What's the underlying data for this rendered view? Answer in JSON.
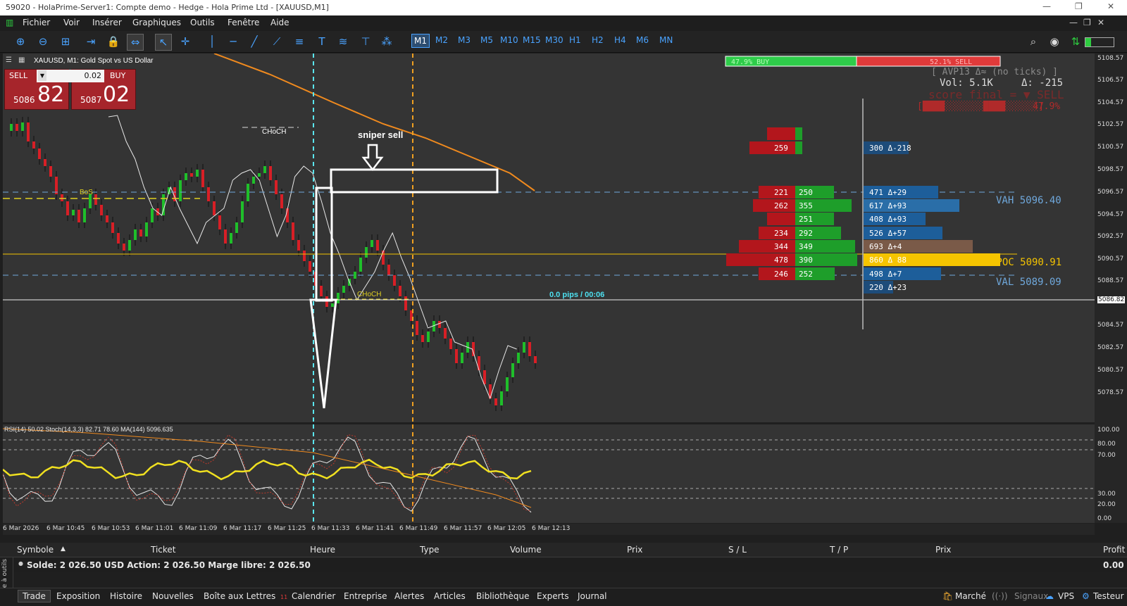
{
  "window": {
    "title": "59020 - HolaPrime-Server1: Compte demo - Hedge - Hola Prime Ltd - [XAUUSD,M1]",
    "controls": [
      "—",
      "❐",
      "✕"
    ]
  },
  "menu": [
    "Fichier",
    "Voir",
    "Insérer",
    "Graphiques",
    "Outils",
    "Fenêtre",
    "Aide"
  ],
  "timeframes": [
    "M1",
    "M2",
    "M3",
    "M5",
    "M10",
    "M15",
    "M30",
    "H1",
    "H2",
    "H4",
    "M6",
    "MN"
  ],
  "chart": {
    "symbol_label": "XAUUSD, M1:  Gold Spot vs US Dollar",
    "trade_panel": {
      "sell_label": "SELL",
      "buy_label": "BUY",
      "lot": "0.02",
      "sell_prefix": "5086",
      "sell_big": "82",
      "buy_prefix": "5087",
      "buy_big": "02"
    },
    "annotations": {
      "choch_top": "CHoCH",
      "bos": "BoS",
      "sniper": "sniper sell",
      "choch_bottom": "CHoCH",
      "pips": "0.0 pips / 00:06"
    },
    "panel": {
      "buy_pct": "47.9% BUY",
      "sell_pct": "52.1% SELL",
      "avp": "[ AVP13  Δ≈ (no ticks) ]",
      "vol": "Vol: 5.1K",
      "delta": "Δ: -215",
      "score": "score final = ▼ SELL",
      "score_bar": "[████░░░░░░░████░░░░░░]",
      "score_pct": "47.9%",
      "vah": "VAH 5096.40",
      "vpoc": "VPOC 5090.91",
      "val": "VAL 5089.09"
    },
    "profile_sell": [
      "259",
      "221",
      "262",
      "234",
      "344",
      "478",
      "246"
    ],
    "profile_buy": [
      "250",
      "355",
      "251",
      "292",
      "349",
      "390",
      "252"
    ],
    "delta_rows": [
      {
        "vol": "300",
        "delta": "Δ-218"
      },
      {
        "vol": "471",
        "delta": "Δ+29"
      },
      {
        "vol": "617",
        "delta": "Δ+93"
      },
      {
        "vol": "408",
        "delta": "Δ+93"
      },
      {
        "vol": "526",
        "delta": "Δ+57"
      },
      {
        "vol": "693",
        "delta": "Δ+4"
      },
      {
        "vol": "860",
        "delta": "Δ 88"
      },
      {
        "vol": "498",
        "delta": "Δ+7"
      },
      {
        "vol": "220",
        "delta": "Δ+23"
      }
    ],
    "price_labels": [
      "5108.57",
      "5106.57",
      "5104.57",
      "5102.57",
      "5100.57",
      "5098.57",
      "5096.57",
      "5094.57",
      "5092.57",
      "5090.57",
      "5088.57",
      "5086.82",
      "5084.57",
      "5082.57",
      "5080.57",
      "5078.57"
    ],
    "current_price": "5086.82"
  },
  "indicator": {
    "label": "RSI(14) 50.02  Stoch(14,3,3) 82.71 78.60  MA(144) 5096.635",
    "levels": [
      "100.00",
      "80.00",
      "70.00",
      "30.00",
      "20.00",
      "0.00"
    ]
  },
  "time_labels": [
    "6 Mar 2026",
    "6 Mar 10:45",
    "6 Mar 10:53",
    "6 Mar 11:01",
    "6 Mar 11:09",
    "6 Mar 11:17",
    "6 Mar 11:25",
    "6 Mar 11:33",
    "6 Mar 11:41",
    "6 Mar 11:49",
    "6 Mar 11:57",
    "6 Mar 12:05",
    "6 Mar 12:13"
  ],
  "trade_table": {
    "columns": [
      "Symbole",
      "Ticket",
      "Heure",
      "Type",
      "Volume",
      "Prix",
      "S / L",
      "T / P",
      "Prix",
      "Profit"
    ],
    "balance": "Solde: 2 026.50 USD  Action: 2 026.50  Marge libre: 2 026.50",
    "profit": "0.00"
  },
  "tabs": [
    "Trade",
    "Exposition",
    "Histoire",
    "Nouvelles",
    "Boîte aux Lettres",
    "Calendrier",
    "Entreprise",
    "Alertes",
    "Articles",
    "Bibliothèque",
    "Experts",
    "Journal"
  ],
  "mail_count": "11",
  "status_right": [
    "Marché",
    "Signaux",
    "VPS",
    "Testeur"
  ],
  "side_label": "Boîte à outils",
  "colors": {
    "accent": "#4aa3ff",
    "bull": "#1fbf2a",
    "bear": "#d81f26",
    "ma_orange": "#f08a1e",
    "vpoc": "#f5c400"
  }
}
